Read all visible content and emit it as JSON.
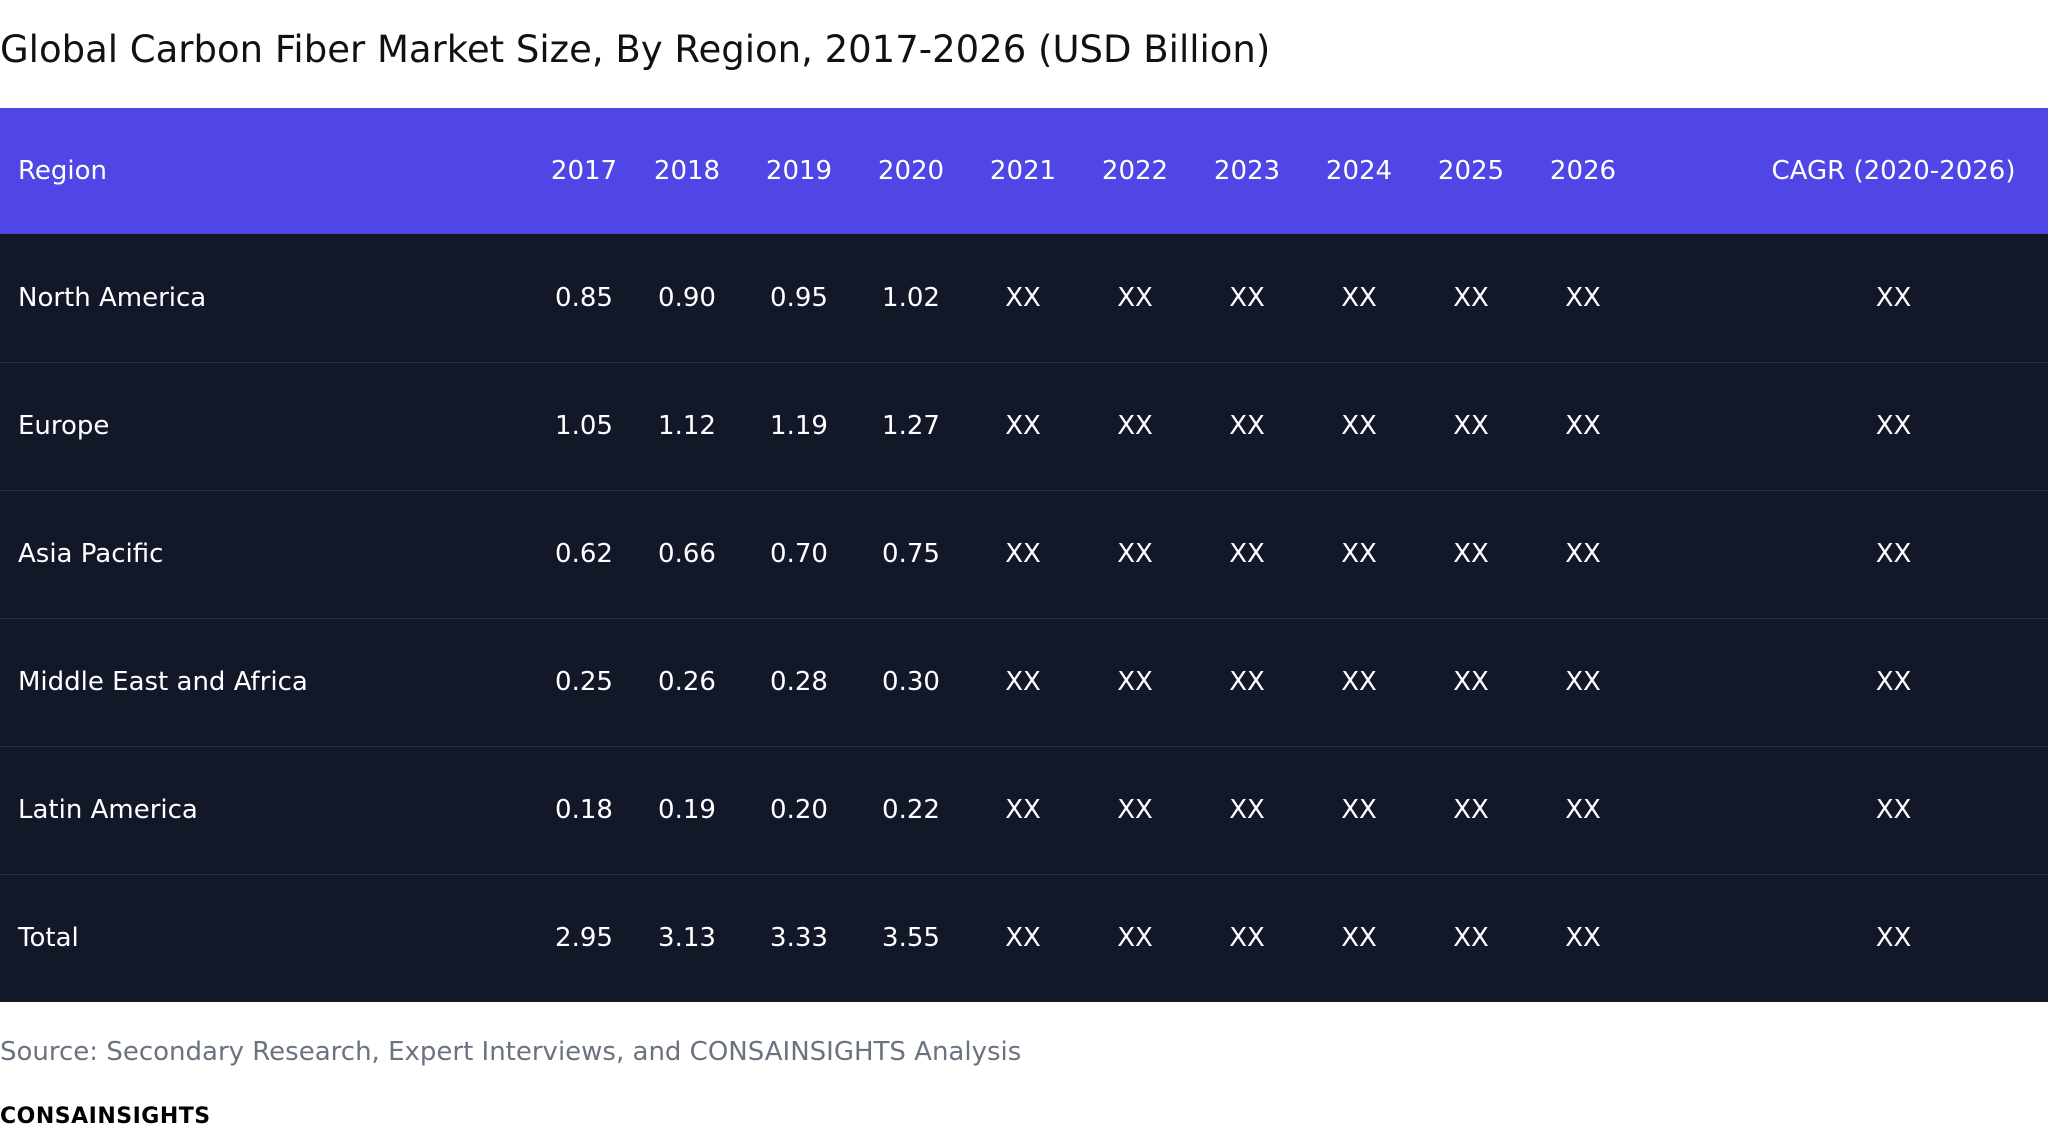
{
  "title": "Global Carbon Fiber Market Size, By Region, 2017-2026 (USD Billion)",
  "table": {
    "headers": [
      "Region",
      "2017",
      "2018",
      "2019",
      "2020",
      "2021",
      "2022",
      "2023",
      "2024",
      "2025",
      "2026",
      "CAGR (2020-2026)"
    ],
    "rows": [
      [
        "North America",
        "0.85",
        "0.90",
        "0.95",
        "1.02",
        "XX",
        "XX",
        "XX",
        "XX",
        "XX",
        "XX",
        "XX"
      ],
      [
        "Europe",
        "1.05",
        "1.12",
        "1.19",
        "1.27",
        "XX",
        "XX",
        "XX",
        "XX",
        "XX",
        "XX",
        "XX"
      ],
      [
        "Asia Pacific",
        "0.62",
        "0.66",
        "0.70",
        "0.75",
        "XX",
        "XX",
        "XX",
        "XX",
        "XX",
        "XX",
        "XX"
      ],
      [
        "Middle East and Africa",
        "0.25",
        "0.26",
        "0.28",
        "0.30",
        "XX",
        "XX",
        "XX",
        "XX",
        "XX",
        "XX",
        "XX"
      ],
      [
        "Latin America",
        "0.18",
        "0.19",
        "0.20",
        "0.22",
        "XX",
        "XX",
        "XX",
        "XX",
        "XX",
        "XX",
        "XX"
      ],
      [
        "Total",
        "2.95",
        "3.13",
        "3.33",
        "3.55",
        "XX",
        "XX",
        "XX",
        "XX",
        "XX",
        "XX",
        "XX"
      ]
    ]
  },
  "source": "Source: Secondary Research, Expert Interviews, and CONSAINSIGHTS Analysis",
  "brand": "CONSAINSIGHTS",
  "colors": {
    "header_background": "#4f46e5",
    "body_background": "#121828",
    "row_divider": "#2a3242",
    "cell_text": "#ffffff",
    "title_text": "#111111",
    "source_text": "#6b7280"
  }
}
